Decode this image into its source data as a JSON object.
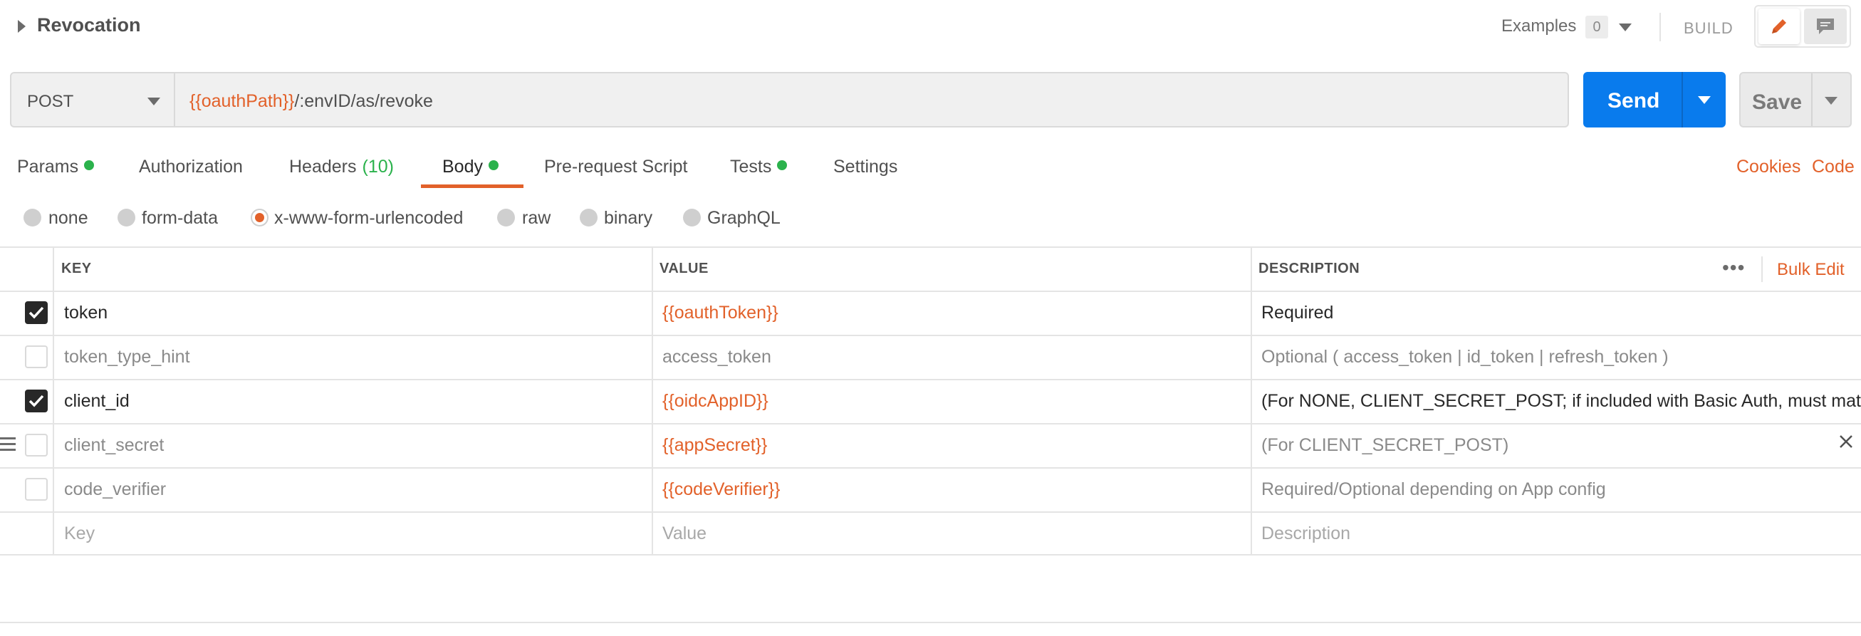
{
  "request": {
    "name": "Revocation",
    "method": "POST",
    "url_var": "{{oauthPath}}",
    "url_rest": "/:envID/as/revoke"
  },
  "header": {
    "examples_label": "Examples",
    "examples_count": "0",
    "build_label": "BUILD"
  },
  "buttons": {
    "send": "Send",
    "save": "Save"
  },
  "tabs": [
    {
      "label": "Params",
      "dot": true
    },
    {
      "label": "Authorization"
    },
    {
      "label": "Headers",
      "count": "(10)"
    },
    {
      "label": "Body",
      "dot": true,
      "active": true
    },
    {
      "label": "Pre-request Script"
    },
    {
      "label": "Tests",
      "dot": true
    },
    {
      "label": "Settings"
    }
  ],
  "right_links": {
    "cookies": "Cookies",
    "code": "Code"
  },
  "body_types": [
    {
      "label": "none",
      "selected": false
    },
    {
      "label": "form-data",
      "selected": false
    },
    {
      "label": "x-www-form-urlencoded",
      "selected": true
    },
    {
      "label": "raw",
      "selected": false
    },
    {
      "label": "binary",
      "selected": false
    },
    {
      "label": "GraphQL",
      "selected": false
    }
  ],
  "table": {
    "headers": {
      "key": "KEY",
      "value": "VALUE",
      "description": "DESCRIPTION"
    },
    "more_icon": "ellipsis-icon",
    "bulk_edit": "Bulk Edit",
    "rows": [
      {
        "checked": true,
        "key": "token",
        "value": "{{oauthToken}}",
        "description": "Required"
      },
      {
        "checked": false,
        "key": "token_type_hint",
        "value": "access_token",
        "description": "Optional ( access_token | id_token | refresh_token )"
      },
      {
        "checked": true,
        "key": "client_id",
        "value": "{{oidcAppID}}",
        "description": "(For NONE, CLIENT_SECRET_POST; if included with Basic Auth, must match HTTP Basic Auth client_id)"
      },
      {
        "checked": false,
        "key": "client_secret",
        "value": "{{appSecret}}",
        "description": "(For CLIENT_SECRET_POST)"
      },
      {
        "checked": false,
        "key": "code_verifier",
        "value": "{{codeVerifier}}",
        "description": "Required/Optional depending on App config"
      }
    ],
    "placeholders": {
      "key": "Key",
      "value": "Value",
      "description": "Description"
    }
  },
  "colors": {
    "accent": "#e2612a",
    "send": "#097bed",
    "status_dot": "#2bb24c"
  }
}
